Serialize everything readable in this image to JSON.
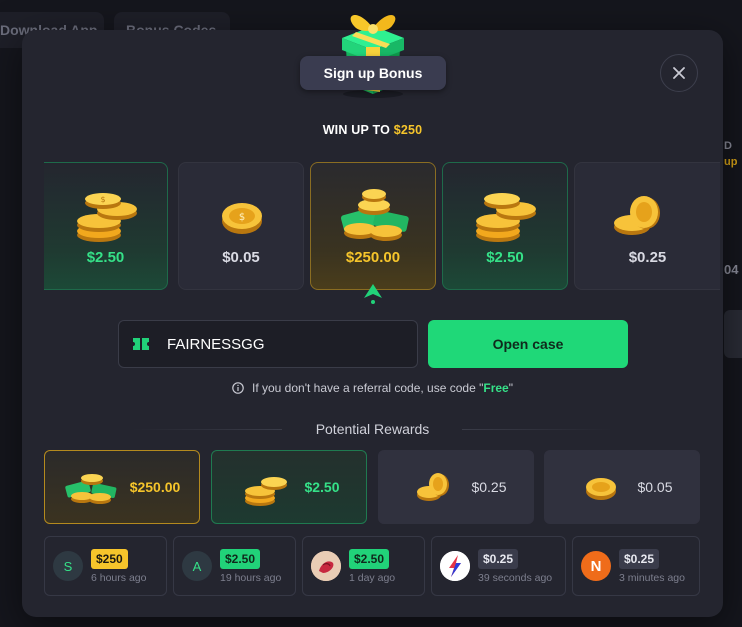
{
  "background": {
    "tabs": [
      "Download App",
      "Bonus Codes"
    ],
    "right_text_1": "D",
    "right_text_2": "up",
    "right_text_3": "04"
  },
  "modal": {
    "title": "Sign up Bonus",
    "close_icon": "close-icon",
    "win_up_prefix": "WIN UP TO ",
    "win_up_amount": "$250"
  },
  "reel": [
    {
      "price": "$2.50",
      "rarity": "green"
    },
    {
      "price": "$0.05",
      "rarity": "common"
    },
    {
      "price": "$250.00",
      "rarity": "gold"
    },
    {
      "price": "$2.50",
      "rarity": "green"
    },
    {
      "price": "$0.25",
      "rarity": "common"
    }
  ],
  "code_input": {
    "value": "FAIRNESSGG",
    "icon": "ticket-icon"
  },
  "open_button": "Open case",
  "hint": {
    "icon": "info-icon",
    "prefix": "If you don't have a referral code, use code \"",
    "code": "Free",
    "suffix": "\""
  },
  "potential_rewards": {
    "title": "Potential Rewards",
    "items": [
      {
        "price": "$250.00",
        "rarity": "gold",
        "color": "#f6c52b"
      },
      {
        "price": "$2.50",
        "rarity": "green",
        "color": "#35e188"
      },
      {
        "price": "$0.25",
        "rarity": "common",
        "color": "#d9dae3"
      },
      {
        "price": "$0.05",
        "rarity": "common",
        "color": "#d9dae3"
      }
    ]
  },
  "live_drops": [
    {
      "avatar": "S",
      "amount": "$250",
      "badge": "gold",
      "time": "6 hours ago"
    },
    {
      "avatar": "A",
      "amount": "$2.50",
      "badge": "green",
      "time": "19 hours ago"
    },
    {
      "avatar": "rose-avatar",
      "amount": "$2.50",
      "badge": "green",
      "time": "1 day ago"
    },
    {
      "avatar": "logo-avatar",
      "amount": "$0.25",
      "badge": "dark",
      "time": "39 seconds ago"
    },
    {
      "avatar": "N",
      "amount": "$0.25",
      "badge": "dark",
      "time": "3 minutes ago"
    }
  ]
}
